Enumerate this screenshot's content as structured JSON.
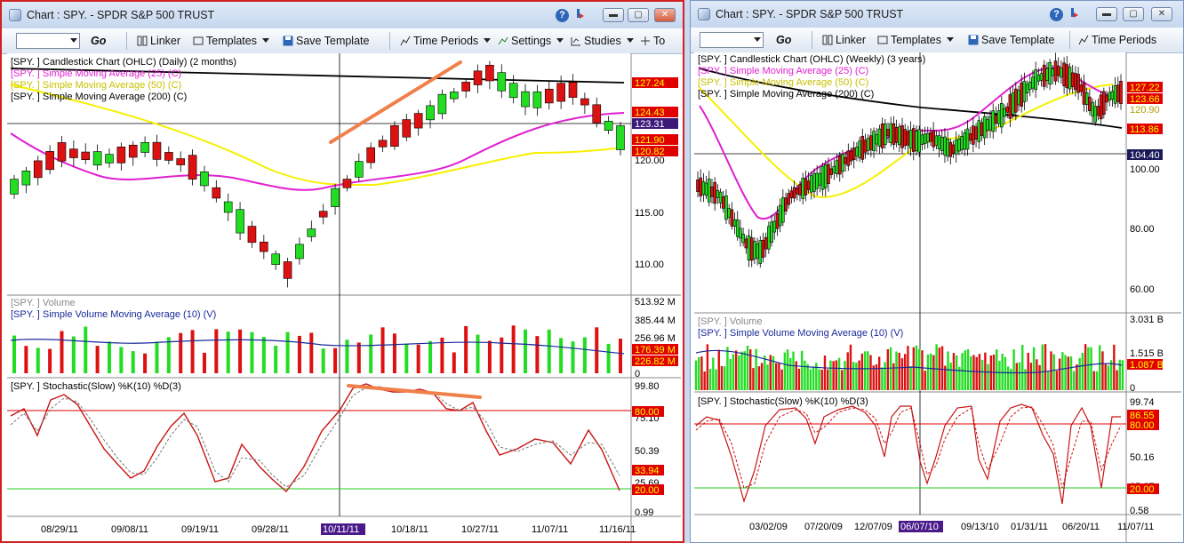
{
  "left": {
    "title": "Chart : SPY.   - SPDR S&P 500 TRUST",
    "toolbar": {
      "go": "Go",
      "linker": "Linker",
      "templates": "Templates",
      "save_template": "Save Template",
      "time_periods": "Time Periods",
      "settings": "Settings",
      "studies": "Studies",
      "to": "To"
    },
    "price_panel": {
      "labels": [
        "[SPY. ] Candlestick Chart (OHLC) (Daily) (2 months)",
        "[SPY. ] Simple Moving Average (25) (C)",
        "[SPY. ] Simple Moving Average (50) (C)",
        "[SPY. ] Simple Moving Average (200) (C)"
      ],
      "axis": [
        "120.00",
        "115.00",
        "110.00"
      ],
      "tags": [
        "127.24",
        "124.43",
        "123.31",
        "121.90",
        "120.82"
      ]
    },
    "volume_panel": {
      "labels": [
        "[SPY. ] Volume",
        "[SPY. ] Simple Volume Moving Average (10) (V)"
      ],
      "axis": [
        "513.92 M",
        "385.44 M",
        "256.96 M",
        "0"
      ],
      "tags": [
        "176.39 M",
        "226.82 M"
      ]
    },
    "stoch_panel": {
      "labels": [
        "[SPY. ] Stochastic(Slow) %K(10) %D(3)"
      ],
      "axis": [
        "99.80",
        "75.10",
        "50.39",
        "25.69",
        "0.99"
      ],
      "tags": [
        "80.00",
        "33.94",
        "20.00"
      ]
    },
    "dates": [
      "08/29/11",
      "09/08/11",
      "09/19/11",
      "09/28/11",
      "10/11/11",
      "10/18/11",
      "10/27/11",
      "11/07/11",
      "11/16/11"
    ]
  },
  "right": {
    "title": "Chart : SPY.   - SPDR S&P 500 TRUST",
    "toolbar": {
      "go": "Go",
      "linker": "Linker",
      "templates": "Templates",
      "save_template": "Save Template",
      "time_periods": "Time Periods"
    },
    "price_panel": {
      "labels": [
        "[SPY. ] Candlestick Chart (OHLC) (Weekly) (3 years)",
        "[SPY. ] Simple Moving Average (25) (C)",
        "[SPY. ] Simple Moving Average (50) (C)",
        "[SPY. ] Simple Moving Average (200) (C)"
      ],
      "axis": [
        "100.00",
        "80.00",
        "60.00"
      ],
      "tags": [
        "127.22",
        "123.66",
        "120.90",
        "113.86",
        "104.40"
      ]
    },
    "volume_panel": {
      "labels": [
        "[SPY. ] Volume",
        "[SPY. ] Simple Volume Moving Average (10) (V)"
      ],
      "axis": [
        "3.031 B",
        "1.515 B",
        "0"
      ],
      "tags": [
        "1.087 B"
      ]
    },
    "stoch_panel": {
      "labels": [
        "[SPY. ] Stochastic(Slow) %K(10) %D(3)"
      ],
      "axis": [
        "99.74",
        "75.95",
        "50.16",
        "25.37",
        "0.58"
      ],
      "tags": [
        "86.55",
        "80.00",
        "20.00"
      ]
    },
    "dates": [
      "03/02/09",
      "07/20/09",
      "12/07/09",
      "06/07/10",
      "09/13/10",
      "01/31/11",
      "06/20/11",
      "11/07/11"
    ]
  },
  "colors": {
    "up": "#22dd22",
    "down": "#dd1111",
    "sma25": "#e020d0",
    "sma50": "#f6f000",
    "sma200": "#000000",
    "stoch_line": "#c81414",
    "volume_avg": "#1a2a9a",
    "trend_annotation": "#f0804a",
    "selected_date": "#4a1a8a"
  }
}
